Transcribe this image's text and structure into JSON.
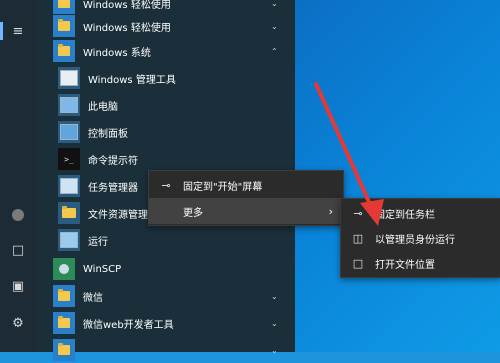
{
  "start_menu": {
    "left_rail": {
      "icons": [
        "hamburger-list-icon",
        "user-avatar-icon",
        "document-icon",
        "pictures-icon",
        "settings-gear-icon"
      ]
    },
    "items": [
      {
        "label": "Windows 轻松使用",
        "type": "folder",
        "expanded": false
      },
      {
        "label": "Windows 系统",
        "type": "folder",
        "expanded": true
      },
      {
        "label": "Windows 管理工具",
        "type": "app"
      },
      {
        "label": "此电脑",
        "type": "app"
      },
      {
        "label": "控制面板",
        "type": "app"
      },
      {
        "label": "命令提示符",
        "type": "app"
      },
      {
        "label": "任务管理器",
        "type": "app"
      },
      {
        "label": "文件资源管理器",
        "type": "app"
      },
      {
        "label": "运行",
        "type": "app"
      },
      {
        "label": "WinSCP",
        "type": "app"
      },
      {
        "label": "微信",
        "type": "folder",
        "expanded": false
      },
      {
        "label": "微信web开发者工具",
        "type": "folder",
        "expanded": false
      }
    ]
  },
  "context_menu": {
    "items": [
      {
        "label": "固定到\"开始\"屏幕",
        "icon": "pin-icon"
      },
      {
        "label": "更多",
        "icon": "",
        "has_submenu": true,
        "highlighted": true
      }
    ]
  },
  "submenu": {
    "items": [
      {
        "label": "固定到任务栏",
        "icon": "pin-icon"
      },
      {
        "label": "以管理员身份运行",
        "icon": "admin-shield-icon"
      },
      {
        "label": "打开文件位置",
        "icon": "file-location-icon"
      }
    ]
  },
  "annotation": {
    "color": "#e53935",
    "type": "arrow"
  },
  "colors": {
    "menu_bg": "#1b2f3a",
    "rail_bg": "#1c2b35",
    "context_bg": "#2b2b2b",
    "tile_blue": "#2a7fc9",
    "desktop": "#0a84d8"
  }
}
